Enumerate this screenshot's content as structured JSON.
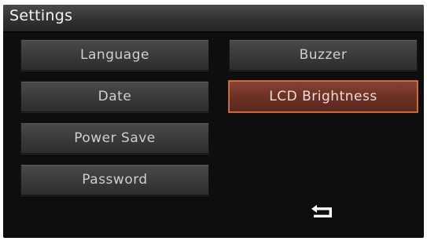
{
  "title": "Settings",
  "buttons": {
    "language": "Language",
    "date": "Date",
    "power_save": "Power Save",
    "password": "Password",
    "buzzer": "Buzzer",
    "lcd_brightness": "LCD Brightness"
  },
  "selected": "lcd_brightness",
  "icons": {
    "back": "back-arrow-icon"
  },
  "colors": {
    "background": "#0e0e0e",
    "button": "#3b3b3b",
    "selected_fill": "#6d3126",
    "selected_border": "#e07a44",
    "text": "#cfcfcf"
  }
}
